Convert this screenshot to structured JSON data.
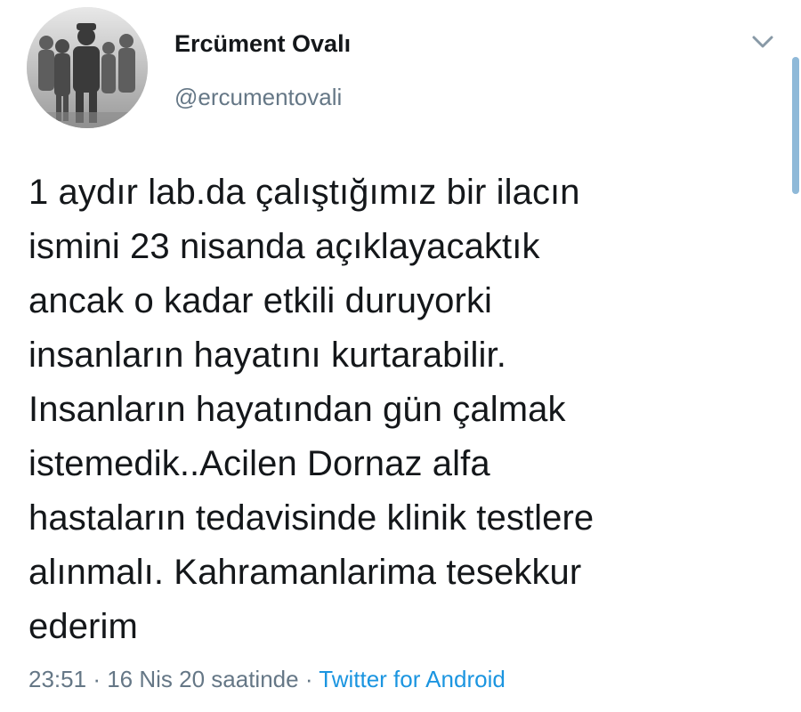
{
  "author": {
    "display_name": "Ercüment Ovalı",
    "handle": "@ercumentovali",
    "avatar_icon": "avatar-photo-icon"
  },
  "menu": {
    "icon": "chevron-down-icon"
  },
  "tweet": {
    "text": "1 aydır lab.da çalıştığımız bir ilacın\nismini 23 nisanda açıklayacaktık\nancak o kadar etkili duruyorki\ninsanların hayatını kurtarabilir.\nInsanların hayatından gün çalmak\nistemedik..Acilen Dornaz alfa\nhastaların tedavisinde klinik testlere\nalınmalı. Kahramanlarima tesekkur\nederim"
  },
  "meta": {
    "time": "23:51",
    "separator": "·",
    "date": "16 Nis 20 saatinde",
    "source": "Twitter for Android"
  },
  "colors": {
    "text": "#14171a",
    "secondary": "#657786",
    "link": "#1b95e0",
    "scrollbar": "#8fb9d8"
  }
}
